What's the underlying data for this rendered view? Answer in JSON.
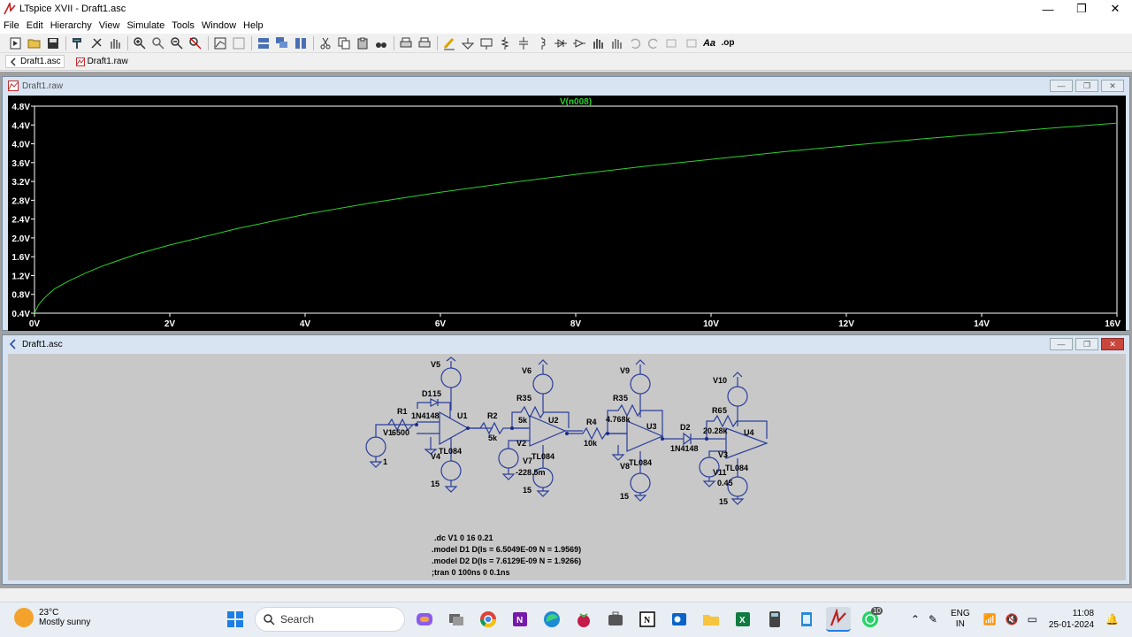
{
  "window": {
    "title": "LTspice XVII - Draft1.asc",
    "minimize": "—",
    "maximize": "❐",
    "close": "✕"
  },
  "menu": [
    "File",
    "Edit",
    "Hierarchy",
    "View",
    "Simulate",
    "Tools",
    "Window",
    "Help"
  ],
  "tabs": [
    {
      "label": "Draft1.asc",
      "active": true
    },
    {
      "label": "Draft1.raw",
      "active": false
    }
  ],
  "plot_window": {
    "title": "Draft1.raw"
  },
  "schematic_window": {
    "title": "Draft1.asc"
  },
  "chart_data": {
    "type": "line",
    "title": "V(n008)",
    "series": [
      {
        "name": "V(n008)",
        "color": "#2bd12b",
        "x": [
          0,
          0.05,
          0.1,
          0.2,
          0.3,
          0.5,
          0.75,
          1,
          1.5,
          2,
          3,
          4,
          5,
          6,
          7,
          8,
          9,
          10,
          11,
          12,
          13,
          14,
          15,
          16
        ],
        "y": [
          0.4,
          0.55,
          0.65,
          0.8,
          0.92,
          1.08,
          1.25,
          1.4,
          1.65,
          1.85,
          2.2,
          2.5,
          2.75,
          2.97,
          3.17,
          3.35,
          3.52,
          3.67,
          3.82,
          3.96,
          4.09,
          4.21,
          4.33,
          4.44
        ]
      }
    ],
    "x_ticks": [
      "0V",
      "2V",
      "4V",
      "6V",
      "8V",
      "10V",
      "12V",
      "14V",
      "16V"
    ],
    "y_ticks": [
      "0.4V",
      "0.8V",
      "1.2V",
      "1.6V",
      "2.0V",
      "2.4V",
      "2.8V",
      "3.2V",
      "3.6V",
      "4.0V",
      "4.4V",
      "4.8V"
    ],
    "xlim": [
      0,
      16
    ],
    "ylim": [
      0.4,
      4.8
    ],
    "grid": false
  },
  "schematic": {
    "labels": {
      "V5": "V5",
      "D1": "D1",
      "D1_15": "15",
      "R1": "R1",
      "V1": "V1",
      "R1_val": "6500",
      "V1_val": "1",
      "N1": "1N4148",
      "U1": "U1",
      "V4": "V4",
      "TL1": "TL084",
      "V4_val": "15",
      "R2": "R2",
      "R2_val": "5k",
      "V6": "V6",
      "R3": "R3",
      "R3_15": "5",
      "R3_val": "5k",
      "U2": "U2",
      "V2": "V2",
      "V7": "V7",
      "TL2": "TL084",
      "V2_val": "-228.5m",
      "V7_val": "15",
      "R4": "R4",
      "R4_val": "10k",
      "V9": "V9",
      "R35": "R3",
      "R35_15": "5",
      "R35_val": "4.768k",
      "U3": "U3",
      "V8": "V8",
      "TL3": "TL084",
      "V8_val": "15",
      "D2": "D2",
      "N2": "1N4148",
      "V10": "V10",
      "R6": "R6",
      "R6_15": "5",
      "R6_val": "20.28k",
      "U4": "U4",
      "V3": "V3",
      "V11": "V11",
      "TL4": "TL084",
      "V3_val": "0.45",
      "V11_val": "15"
    },
    "directives": [
      ".dc V1 0 16 0.21",
      ".model D1 D(Is = 6.5049E-09 N = 1.9569)",
      ".model D2 D(Is = 7.6129E-09 N = 1.9266)",
      ";tran 0 100ns 0 0.1ns"
    ]
  },
  "taskbar": {
    "temperature": "23°C",
    "weather": "Mostly sunny",
    "search_placeholder": "Search",
    "lang1": "ENG",
    "lang2": "IN",
    "time": "11:08",
    "date": "25-01-2024",
    "whatsapp_badge": "10"
  }
}
